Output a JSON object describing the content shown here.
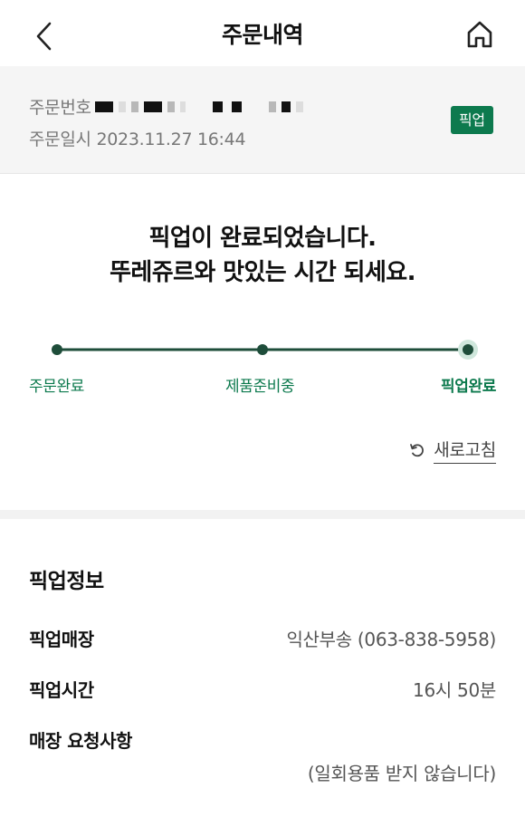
{
  "header": {
    "title": "주문내역",
    "back_icon": "chevron-left-icon",
    "home_icon": "home-icon"
  },
  "order": {
    "number_label": "주문번호",
    "date_text": "주문일시 2023.11.27 16:44",
    "badge": "픽업"
  },
  "status": {
    "line1": "픽업이 완료되었습니다.",
    "line2": "뚜레쥬르와 맛있는 시간 되세요.",
    "steps": [
      {
        "label": "주문완료"
      },
      {
        "label": "제품준비중"
      },
      {
        "label": "픽업완료"
      }
    ],
    "refresh_label": "새로고침",
    "refresh_icon": "refresh-icon"
  },
  "pickup_info": {
    "title": "픽업정보",
    "rows": [
      {
        "label": "픽업매장",
        "value": "익산부송 (063-838-5958)"
      },
      {
        "label": "픽업시간",
        "value": "16시 50분"
      },
      {
        "label": "매장 요청사항",
        "value": "(일회용품 받지 않습니다)"
      }
    ]
  },
  "colors": {
    "accent": "#0d7a4e",
    "progress_line": "#1e4d3a",
    "band_bg": "#f5f5f5"
  }
}
